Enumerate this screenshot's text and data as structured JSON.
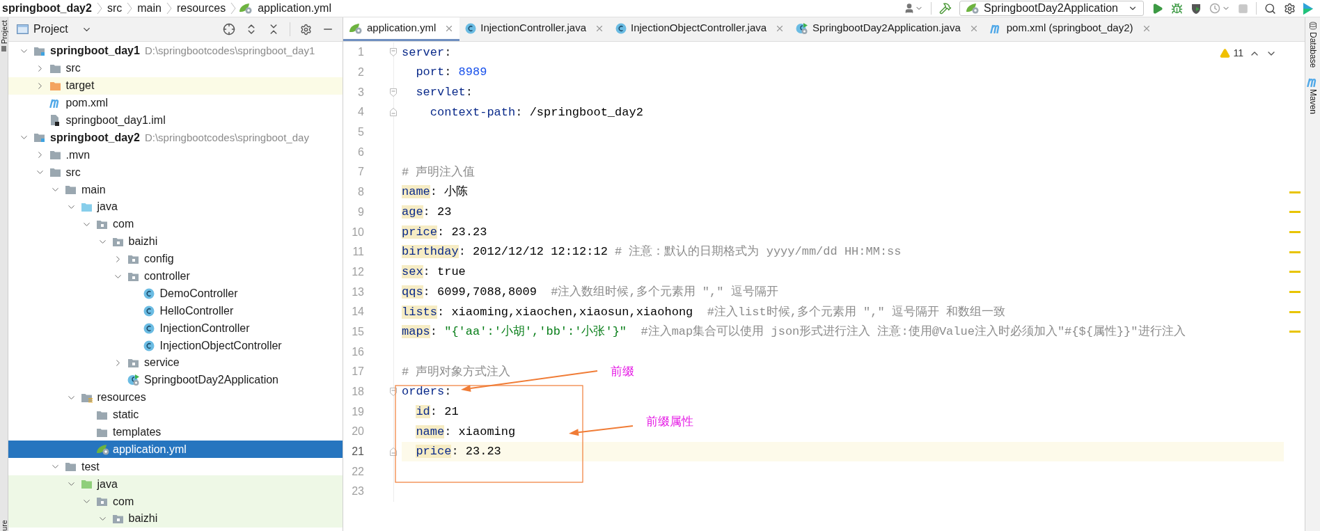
{
  "breadcrumb": [
    {
      "text": "springboot_day2",
      "kind": "project"
    },
    {
      "text": "src",
      "kind": "folder"
    },
    {
      "text": "main",
      "kind": "folder"
    },
    {
      "text": "resources",
      "kind": "folder"
    },
    {
      "text": "application.yml",
      "kind": "yaml"
    }
  ],
  "run_configuration": "SpringbootDay2Application",
  "stop": {
    "disabled": true
  },
  "side_tabs": {
    "left": [
      "Project",
      "ure"
    ],
    "right": [
      "Database",
      "Maven"
    ]
  },
  "project_panel": {
    "title": "Project",
    "tree": [
      {
        "name": "springboot_day1",
        "kind": "module",
        "path": "D:\\springbootcodes\\springboot_day1",
        "expanded": true,
        "selected": false,
        "children": [
          {
            "name": "src",
            "kind": "folder",
            "expanded": false,
            "selected": false
          },
          {
            "name": "target",
            "kind": "excluded-folder",
            "expanded": false,
            "selected": false
          },
          {
            "name": "pom.xml",
            "kind": "maven",
            "selected": false
          },
          {
            "name": "springboot_day1.iml",
            "kind": "iml",
            "selected": false
          }
        ]
      },
      {
        "name": "springboot_day2",
        "kind": "module",
        "path": "D:\\springbootcodes\\springboot_day",
        "expanded": true,
        "selected": false,
        "children": [
          {
            "name": ".mvn",
            "kind": "folder",
            "expanded": false,
            "selected": false
          },
          {
            "name": "src",
            "kind": "folder",
            "expanded": true,
            "selected": false,
            "children": [
              {
                "name": "main",
                "kind": "folder",
                "expanded": true,
                "selected": false,
                "children": [
                  {
                    "name": "java",
                    "kind": "source-folder",
                    "expanded": true,
                    "selected": false,
                    "children": [
                      {
                        "name": "com",
                        "kind": "package",
                        "expanded": true,
                        "selected": false,
                        "children": [
                          {
                            "name": "baizhi",
                            "kind": "package",
                            "expanded": true,
                            "selected": false,
                            "children": [
                              {
                                "name": "config",
                                "kind": "package",
                                "expanded": false,
                                "selected": false
                              },
                              {
                                "name": "controller",
                                "kind": "package",
                                "expanded": true,
                                "selected": false,
                                "children": [
                                  {
                                    "name": "DemoController",
                                    "kind": "class",
                                    "selected": false
                                  },
                                  {
                                    "name": "HelloController",
                                    "kind": "class",
                                    "selected": false
                                  },
                                  {
                                    "name": "InjectionController",
                                    "kind": "class",
                                    "selected": false
                                  },
                                  {
                                    "name": "InjectionObjectController",
                                    "kind": "class",
                                    "selected": false
                                  }
                                ]
                              },
                              {
                                "name": "service",
                                "kind": "package",
                                "expanded": false,
                                "selected": false
                              },
                              {
                                "name": "SpringbootDay2Application",
                                "kind": "spring-app",
                                "selected": false
                              }
                            ]
                          }
                        ]
                      }
                    ]
                  },
                  {
                    "name": "resources",
                    "kind": "resource-folder",
                    "expanded": true,
                    "selected": false,
                    "children": [
                      {
                        "name": "static",
                        "kind": "folder",
                        "selected": false
                      },
                      {
                        "name": "templates",
                        "kind": "folder",
                        "selected": false
                      },
                      {
                        "name": "application.yml",
                        "kind": "yaml",
                        "selected": true
                      }
                    ]
                  }
                ]
              },
              {
                "name": "test",
                "kind": "folder",
                "expanded": true,
                "selected": false,
                "children": [
                  {
                    "name": "java",
                    "kind": "test-folder",
                    "expanded": true,
                    "selected": false,
                    "children": [
                      {
                        "name": "com",
                        "kind": "test-package",
                        "expanded": true,
                        "selected": false,
                        "children": [
                          {
                            "name": "baizhi",
                            "kind": "test-package",
                            "expanded": true,
                            "selected": false
                          }
                        ]
                      }
                    ]
                  }
                ]
              }
            ]
          }
        ]
      }
    ]
  },
  "editor": {
    "tabs": [
      {
        "label": "application.yml",
        "kind": "yaml",
        "selected": true
      },
      {
        "label": "InjectionController.java",
        "kind": "class",
        "selected": false
      },
      {
        "label": "InjectionObjectController.java",
        "kind": "class",
        "selected": false
      },
      {
        "label": "SpringbootDay2Application.java",
        "kind": "spring-app",
        "selected": false
      },
      {
        "label": "pom.xml (springboot_day2)",
        "kind": "maven",
        "selected": false
      }
    ],
    "warning_count": "11",
    "lines": [
      {
        "number": "1",
        "current": false,
        "warning": false,
        "tokens": [
          {
            "kind": "key",
            "text": "server",
            "highlighted": false
          },
          {
            "kind": "punct",
            "text": ":"
          }
        ],
        "children": [
          {
            "number": "2",
            "current": false,
            "warning": false,
            "tokens": [
              {
                "kind": "key",
                "text": "port",
                "highlighted": false
              },
              {
                "kind": "punct",
                "text": ": "
              },
              {
                "kind": "number",
                "text": "8989"
              }
            ]
          },
          {
            "number": "3",
            "current": false,
            "warning": false,
            "tokens": [
              {
                "kind": "key",
                "text": "servlet",
                "highlighted": false
              },
              {
                "kind": "punct",
                "text": ":"
              }
            ],
            "children": [
              {
                "number": "4",
                "current": false,
                "warning": false,
                "tokens": [
                  {
                    "kind": "key",
                    "text": "context-path",
                    "highlighted": false
                  },
                  {
                    "kind": "punct",
                    "text": ": "
                  },
                  {
                    "kind": "plain",
                    "text": "/springboot_day2"
                  }
                ]
              }
            ]
          }
        ]
      },
      {
        "number": "5",
        "current": false,
        "warning": false
      },
      {
        "number": "6",
        "current": false,
        "warning": false
      },
      {
        "number": "7",
        "current": false,
        "warning": false,
        "tokens": [
          {
            "kind": "comment",
            "text": "# 声明注入值"
          }
        ]
      },
      {
        "number": "8",
        "current": false,
        "warning": true,
        "tokens": [
          {
            "kind": "key",
            "text": "name",
            "highlighted": true
          },
          {
            "kind": "punct",
            "text": ": "
          },
          {
            "kind": "plain",
            "text": "小陈"
          }
        ]
      },
      {
        "number": "9",
        "current": false,
        "warning": true,
        "tokens": [
          {
            "kind": "key",
            "text": "age",
            "highlighted": true
          },
          {
            "kind": "punct",
            "text": ": "
          },
          {
            "kind": "plain",
            "text": "23"
          }
        ]
      },
      {
        "number": "10",
        "current": false,
        "warning": true,
        "tokens": [
          {
            "kind": "key",
            "text": "price",
            "highlighted": true
          },
          {
            "kind": "punct",
            "text": ": "
          },
          {
            "kind": "plain",
            "text": "23.23"
          }
        ]
      },
      {
        "number": "11",
        "current": false,
        "warning": true,
        "tokens": [
          {
            "kind": "key",
            "text": "birthday",
            "highlighted": true
          },
          {
            "kind": "punct",
            "text": ": "
          },
          {
            "kind": "plain",
            "text": "2012/12/12 12:12:12 "
          },
          {
            "kind": "comment",
            "text": "# 注意：默认的日期格式为 yyyy/mm/dd HH:MM:ss"
          }
        ]
      },
      {
        "number": "12",
        "current": false,
        "warning": true,
        "tokens": [
          {
            "kind": "key",
            "text": "sex",
            "highlighted": true
          },
          {
            "kind": "punct",
            "text": ": "
          },
          {
            "kind": "plain",
            "text": "true"
          }
        ]
      },
      {
        "number": "13",
        "current": false,
        "warning": true,
        "tokens": [
          {
            "kind": "key",
            "text": "qqs",
            "highlighted": true
          },
          {
            "kind": "punct",
            "text": ": "
          },
          {
            "kind": "plain",
            "text": "6099,7088,8009  "
          },
          {
            "kind": "comment",
            "text": "#注入数组时候,多个元素用 \",\" 逗号隔开"
          }
        ]
      },
      {
        "number": "14",
        "current": false,
        "warning": true,
        "tokens": [
          {
            "kind": "key",
            "text": "lists",
            "highlighted": true
          },
          {
            "kind": "punct",
            "text": ": "
          },
          {
            "kind": "plain",
            "text": "xiaoming,xiaochen,xiaosun,xiaohong  "
          },
          {
            "kind": "comment",
            "text": "#注入list时候,多个元素用 \",\" 逗号隔开 和数组一致"
          }
        ]
      },
      {
        "number": "15",
        "current": false,
        "warning": true,
        "tokens": [
          {
            "kind": "key",
            "text": "maps",
            "highlighted": true
          },
          {
            "kind": "punct",
            "text": ": "
          },
          {
            "kind": "string",
            "text": "\"{'aa':'小胡','bb':'小张'}\"  "
          },
          {
            "kind": "comment",
            "text": "#注入map集合可以使用 json形式进行注入 注意:使用@Value注入时必须加入\"#{${属性}}\"进行注入"
          }
        ]
      },
      {
        "number": "16",
        "current": false,
        "warning": false
      },
      {
        "number": "17",
        "current": false,
        "warning": false,
        "tokens": [
          {
            "kind": "comment",
            "text": "# 声明对象方式注入"
          }
        ]
      },
      {
        "number": "18",
        "current": false,
        "warning": false,
        "tokens": [
          {
            "kind": "key",
            "text": "orders",
            "highlighted": false
          },
          {
            "kind": "punct",
            "text": ":"
          }
        ],
        "children": [
          {
            "number": "19",
            "current": false,
            "warning": false,
            "tokens": [
              {
                "kind": "key",
                "text": "id",
                "highlighted": true
              },
              {
                "kind": "punct",
                "text": ": "
              },
              {
                "kind": "plain",
                "text": "21"
              }
            ]
          },
          {
            "number": "20",
            "current": false,
            "warning": false,
            "tokens": [
              {
                "kind": "key",
                "text": "name",
                "highlighted": true
              },
              {
                "kind": "punct",
                "text": ": "
              },
              {
                "kind": "plain",
                "text": "xiaoming"
              }
            ]
          },
          {
            "number": "21",
            "current": true,
            "warning": false,
            "tokens": [
              {
                "kind": "key",
                "text": "price",
                "highlighted": true
              },
              {
                "kind": "punct",
                "text": ": "
              },
              {
                "kind": "plain",
                "text": "23.23"
              }
            ]
          }
        ]
      },
      {
        "number": "22",
        "current": false,
        "warning": false
      },
      {
        "number": "23",
        "current": false,
        "warning": false
      }
    ],
    "annotations": [
      {
        "text": "前缀"
      },
      {
        "text": "前缀属性"
      }
    ]
  }
}
